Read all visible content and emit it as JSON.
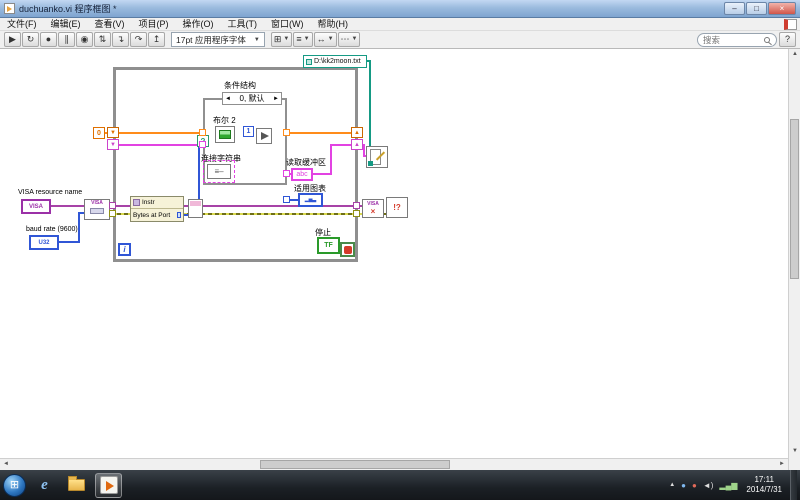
{
  "window": {
    "title": "duchuanko.vi 程序框图 *",
    "minimize": "–",
    "maximize": "□",
    "close": "×"
  },
  "menu": {
    "items": [
      "文件(F)",
      "编辑(E)",
      "查看(V)",
      "项目(P)",
      "操作(O)",
      "工具(T)",
      "窗口(W)",
      "帮助(H)"
    ]
  },
  "toolbar": {
    "buttons": [
      {
        "name": "run-button",
        "glyph": "▶"
      },
      {
        "name": "run-continuous-button",
        "glyph": "↻"
      },
      {
        "name": "abort-button",
        "glyph": "●"
      },
      {
        "name": "pause-button",
        "glyph": "∥"
      },
      {
        "name": "highlight-execution-button",
        "glyph": "◉"
      },
      {
        "name": "retain-wire-values-button",
        "glyph": "⇅"
      },
      {
        "name": "step-into-button",
        "glyph": "↴"
      },
      {
        "name": "step-over-button",
        "glyph": "↷"
      },
      {
        "name": "step-out-button",
        "glyph": "↥"
      }
    ],
    "font_selector": "17pt 应用程序字体",
    "dropdowns": [
      {
        "name": "align-objects-dropdown",
        "glyph": "⊞"
      },
      {
        "name": "distribute-objects-dropdown",
        "glyph": "≡"
      },
      {
        "name": "resize-objects-dropdown",
        "glyph": "↔"
      },
      {
        "name": "reorder-dropdown",
        "glyph": "⋯"
      }
    ],
    "search_placeholder": "搜索",
    "help": "?"
  },
  "diagram": {
    "path_constant": "D:\\kk2moon.txt",
    "case": {
      "label": "条件结构",
      "arrow_left": "◄",
      "selector_value": "0, 默认",
      "arrow_right": "►",
      "selector_terminal": "?"
    },
    "boolean2": {
      "label": "布尔 2"
    },
    "one_constant": "1",
    "zero_constant": "0",
    "concat_label": "连接字符串",
    "concat_glyph": "≡–",
    "read_buffer": {
      "label": "读取缓冲区",
      "text": "abc"
    },
    "chart": {
      "label": "适用图表",
      "glyph": "▂▅▃"
    },
    "stop": {
      "label": "停止",
      "terminal": "TF"
    },
    "visa_resource": {
      "label": "VISA resource name",
      "terminal": "VISA"
    },
    "baud_rate": {
      "label": "baud rate (9600)",
      "terminal": "U32"
    },
    "property_node": {
      "header": "Instr",
      "row": "Bytes at Port"
    },
    "visa_configure": {
      "text": "VISA"
    },
    "visa_close": {
      "text": "VISA",
      "x": "×"
    },
    "error_handler": {
      "text": "!?"
    },
    "iteration_terminal": "i",
    "shift_up": "▲",
    "shift_down": "▼"
  },
  "taskbar": {
    "start_glyph": "⊞",
    "ie_glyph": "e",
    "tray": [
      "▲",
      "●",
      "●",
      "◄)",
      "▂▄▆"
    ],
    "clock": {
      "time": "17:11",
      "date": "2014/7/31"
    }
  }
}
